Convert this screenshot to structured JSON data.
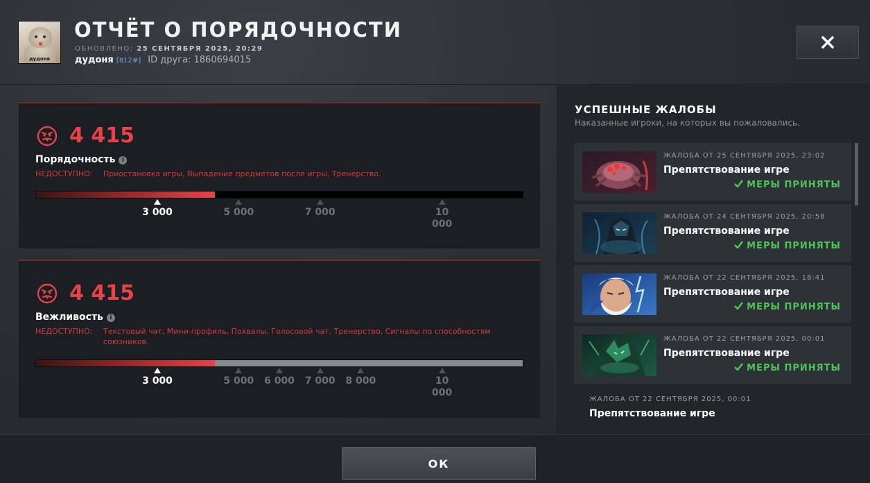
{
  "header": {
    "title": "ОТЧЁТ О ПОРЯДОЧНОСТИ",
    "updated_label": "ОБНОВЛЕНО:",
    "updated_value": "25 СЕНТЯБРЯ 2025, 20:29",
    "username": "дудоня",
    "user_tag": "[812#]",
    "friend_id": "ID друга: 1860694015",
    "avatar_caption": "дудоня"
  },
  "panels": {
    "conduct": {
      "score": "4 415",
      "label": "Порядочность",
      "unavailable_label": "НЕДОСТУПНО:",
      "unavailable_list": "Приостановка игры, Выпадение предметов после игры, Тренерство.",
      "progress": 0.368,
      "ticks": [
        {
          "value": "3 000",
          "current": true
        },
        {
          "value": "5 000",
          "current": false
        },
        {
          "value": "7 000",
          "current": false
        },
        {
          "value": "10 000",
          "current": false
        }
      ]
    },
    "courtesy": {
      "score": "4 415",
      "label": "Вежливость",
      "unavailable_label": "НЕДОСТУПНО:",
      "unavailable_list": "Текстовый чат, Мини-профиль, Похвалы, Голосовой чат, Тренерство, Сигналы по способностям союзников.",
      "progress": 0.368,
      "ticks": [
        {
          "value": "3 000",
          "current": true
        },
        {
          "value": "5 000",
          "current": false
        },
        {
          "value": "6 000",
          "current": false
        },
        {
          "value": "7 000",
          "current": false
        },
        {
          "value": "8 000",
          "current": false
        },
        {
          "value": "10 000",
          "current": false
        }
      ]
    }
  },
  "reports_section": {
    "title": "УСПЕШНЫЕ ЖАЛОБЫ",
    "subtitle": "Наказанные игроки, на которых вы пожаловались.",
    "items": [
      {
        "when": "ЖАЛОБА ОТ 25 СЕНТЯБРЯ 2025, 23:02",
        "reason": "Препятствование игре",
        "status": "МЕРЫ ПРИНЯТЫ",
        "hero_icon": "broodmother-portrait"
      },
      {
        "when": "ЖАЛОБА ОТ 24 СЕНТЯБРЯ 2025, 20:58",
        "reason": "Препятствование игре",
        "status": "МЕРЫ ПРИНЯТЫ",
        "hero_icon": "abaddon-portrait"
      },
      {
        "when": "ЖАЛОБА ОТ 22 СЕНТЯБРЯ 2025, 18:41",
        "reason": "Препятствование игре",
        "status": "МЕРЫ ПРИНЯТЫ",
        "hero_icon": "zeus-portrait"
      },
      {
        "when": "ЖАЛОБА ОТ 22 СЕНТЯБРЯ 2025, 00:01",
        "reason": "Препятствование игре",
        "status": "МЕРЫ ПРИНЯТЫ",
        "hero_icon": "underlord-portrait"
      },
      {
        "when": "ЖАЛОБА ОТ 22 СЕНТЯБРЯ 2025, 00:01",
        "reason": "Препятствование игре"
      }
    ]
  },
  "footer": {
    "ok_label": "ОК"
  },
  "colors": {
    "accent_red": "#e8434a",
    "success_green": "#4fc15a",
    "panel_bg": "#1b1e22"
  }
}
